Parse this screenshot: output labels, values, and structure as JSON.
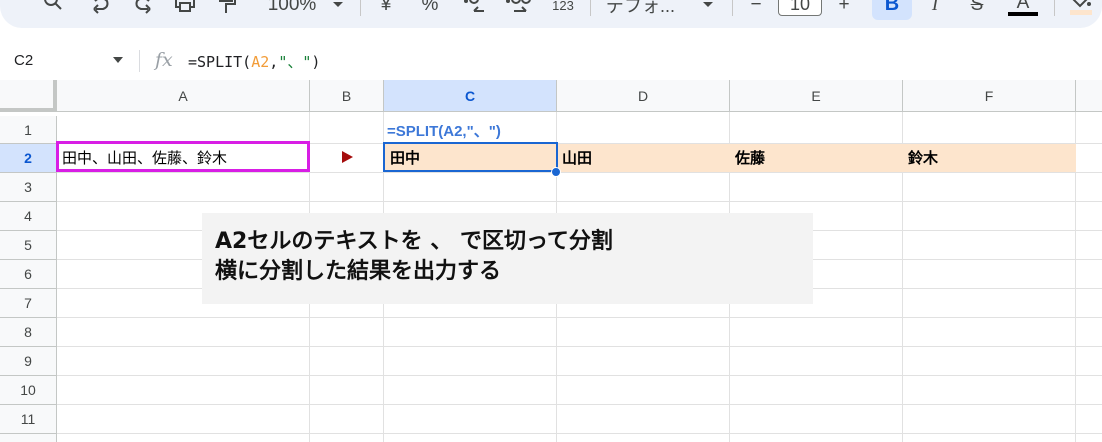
{
  "toolbar": {
    "zoom": "100%",
    "currency": "¥",
    "percent": "%",
    "number_format": "123",
    "font_name": "デフォ...",
    "font_size_minus": "−",
    "font_size": "10",
    "font_size_plus": "+",
    "bold": "B",
    "italic": "I",
    "strikethrough": "S",
    "text_color": "A"
  },
  "formula_bar": {
    "cell_ref": "C2",
    "fx": "fx",
    "formula_prefix": "=SPLIT(",
    "formula_ref": "A2",
    "formula_comma": ",",
    "formula_string": "\"、\"",
    "formula_suffix": ")"
  },
  "grid": {
    "columns": [
      "A",
      "B",
      "C",
      "D",
      "E",
      "F"
    ],
    "selected_column": "C",
    "rows": [
      "1",
      "2",
      "3",
      "4",
      "5",
      "6",
      "7",
      "8",
      "9",
      "10",
      "11"
    ],
    "selected_row": "2",
    "cells": {
      "C1": "=SPLIT(A2,\"、\")",
      "A2": "田中、山田、佐藤、鈴木",
      "C2": "田中",
      "D2": "山田",
      "E2": "佐藤",
      "F2": "鈴木"
    },
    "colors": {
      "highlight_fill": "#fde5cd",
      "source_border": "#d81ee5",
      "selection": "#1a66d2",
      "arrow": "#a50d0d",
      "formula_label": "#3d78d8"
    }
  },
  "annotation": {
    "line1": "A2セルのテキストを 、 で区切って分割",
    "line2": "横に分割した結果を出力する"
  }
}
